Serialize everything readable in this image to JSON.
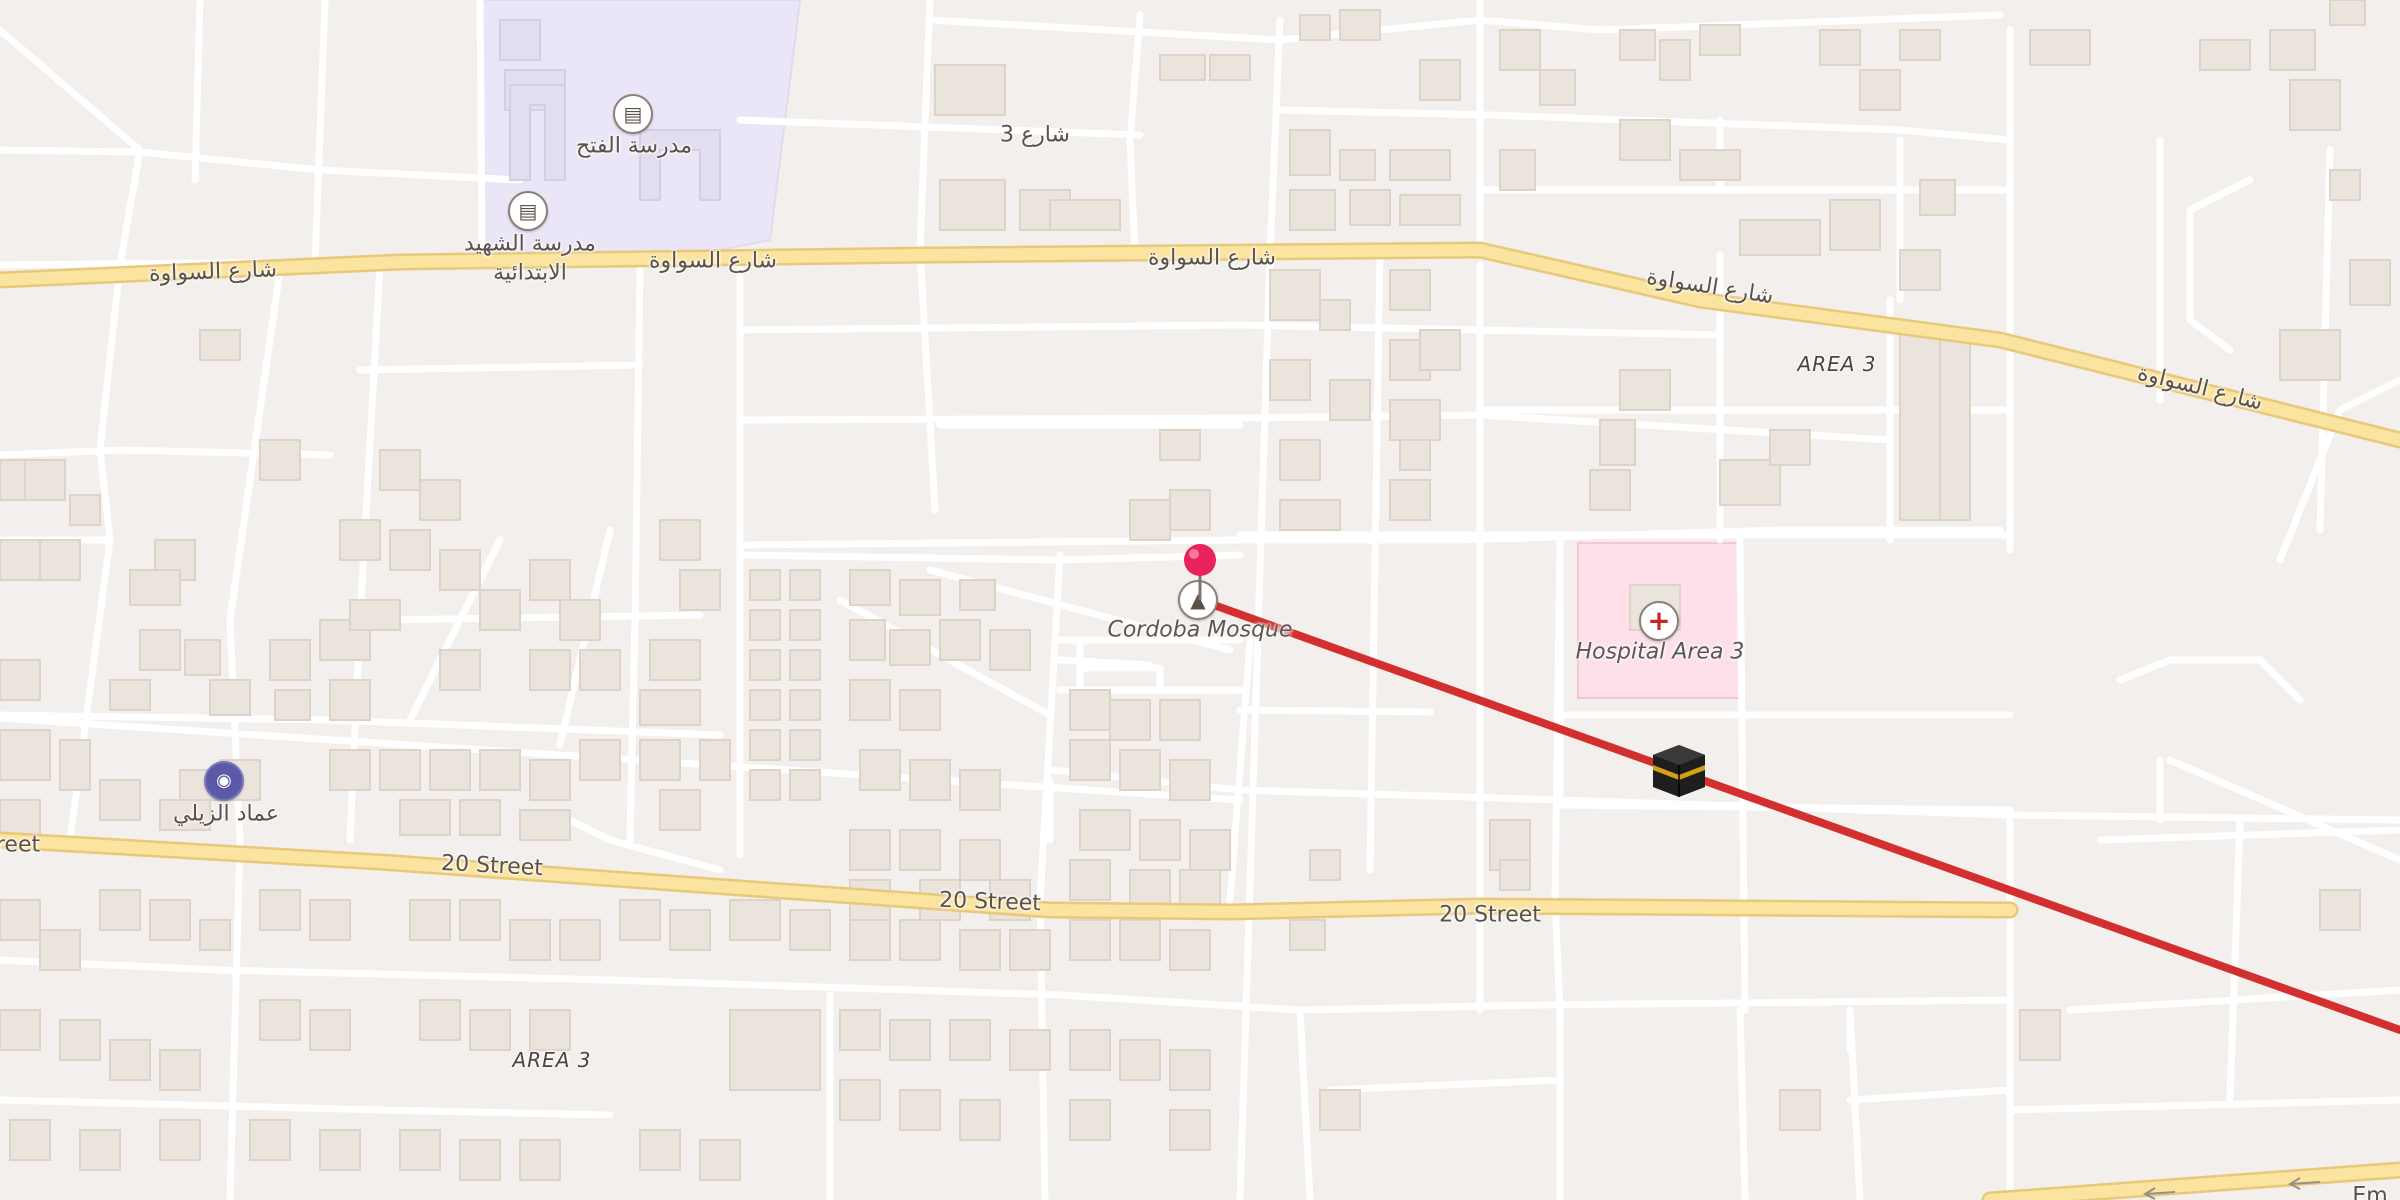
{
  "map": {
    "background_color": "#f2efec",
    "route_color": "#d32f2f",
    "major_road_color": "#fbe3a0",
    "school_area_color": "#ebe6f7",
    "hospital_area_color": "#fde0ea"
  },
  "roads": {
    "sawawa_1": "شارع السواوة",
    "sawawa_2": "شارع السواوة",
    "sawawa_3": "شارع السواوة",
    "sawawa_4": "شارع السواوة",
    "sawawa_5": "شارع السواوة",
    "street3": "شارع 3",
    "street20_partial": "reet",
    "street20_1": "20 Street",
    "street20_2": "20 Street",
    "street20_3": "20 Street",
    "bottom_right": "Em"
  },
  "areas": {
    "area3_top": "AREA 3",
    "area3_bottom": "AREA 3"
  },
  "pois": {
    "school_fateh": "مدرسة الفتح",
    "school_shaheed_1": "مدرسة الشهيد",
    "school_shaheed_2": "الابتدائية",
    "mosque": "Cordoba Mosque",
    "hospital": "Hospital Area 3",
    "camera_place": "عماد الزيلي"
  },
  "icons": {
    "school": "school-icon",
    "mosque": "mosque-icon",
    "hospital": "hospital-cross-icon",
    "camera": "camera-icon",
    "pin": "location-pin-icon",
    "kaaba": "kaaba-icon"
  }
}
